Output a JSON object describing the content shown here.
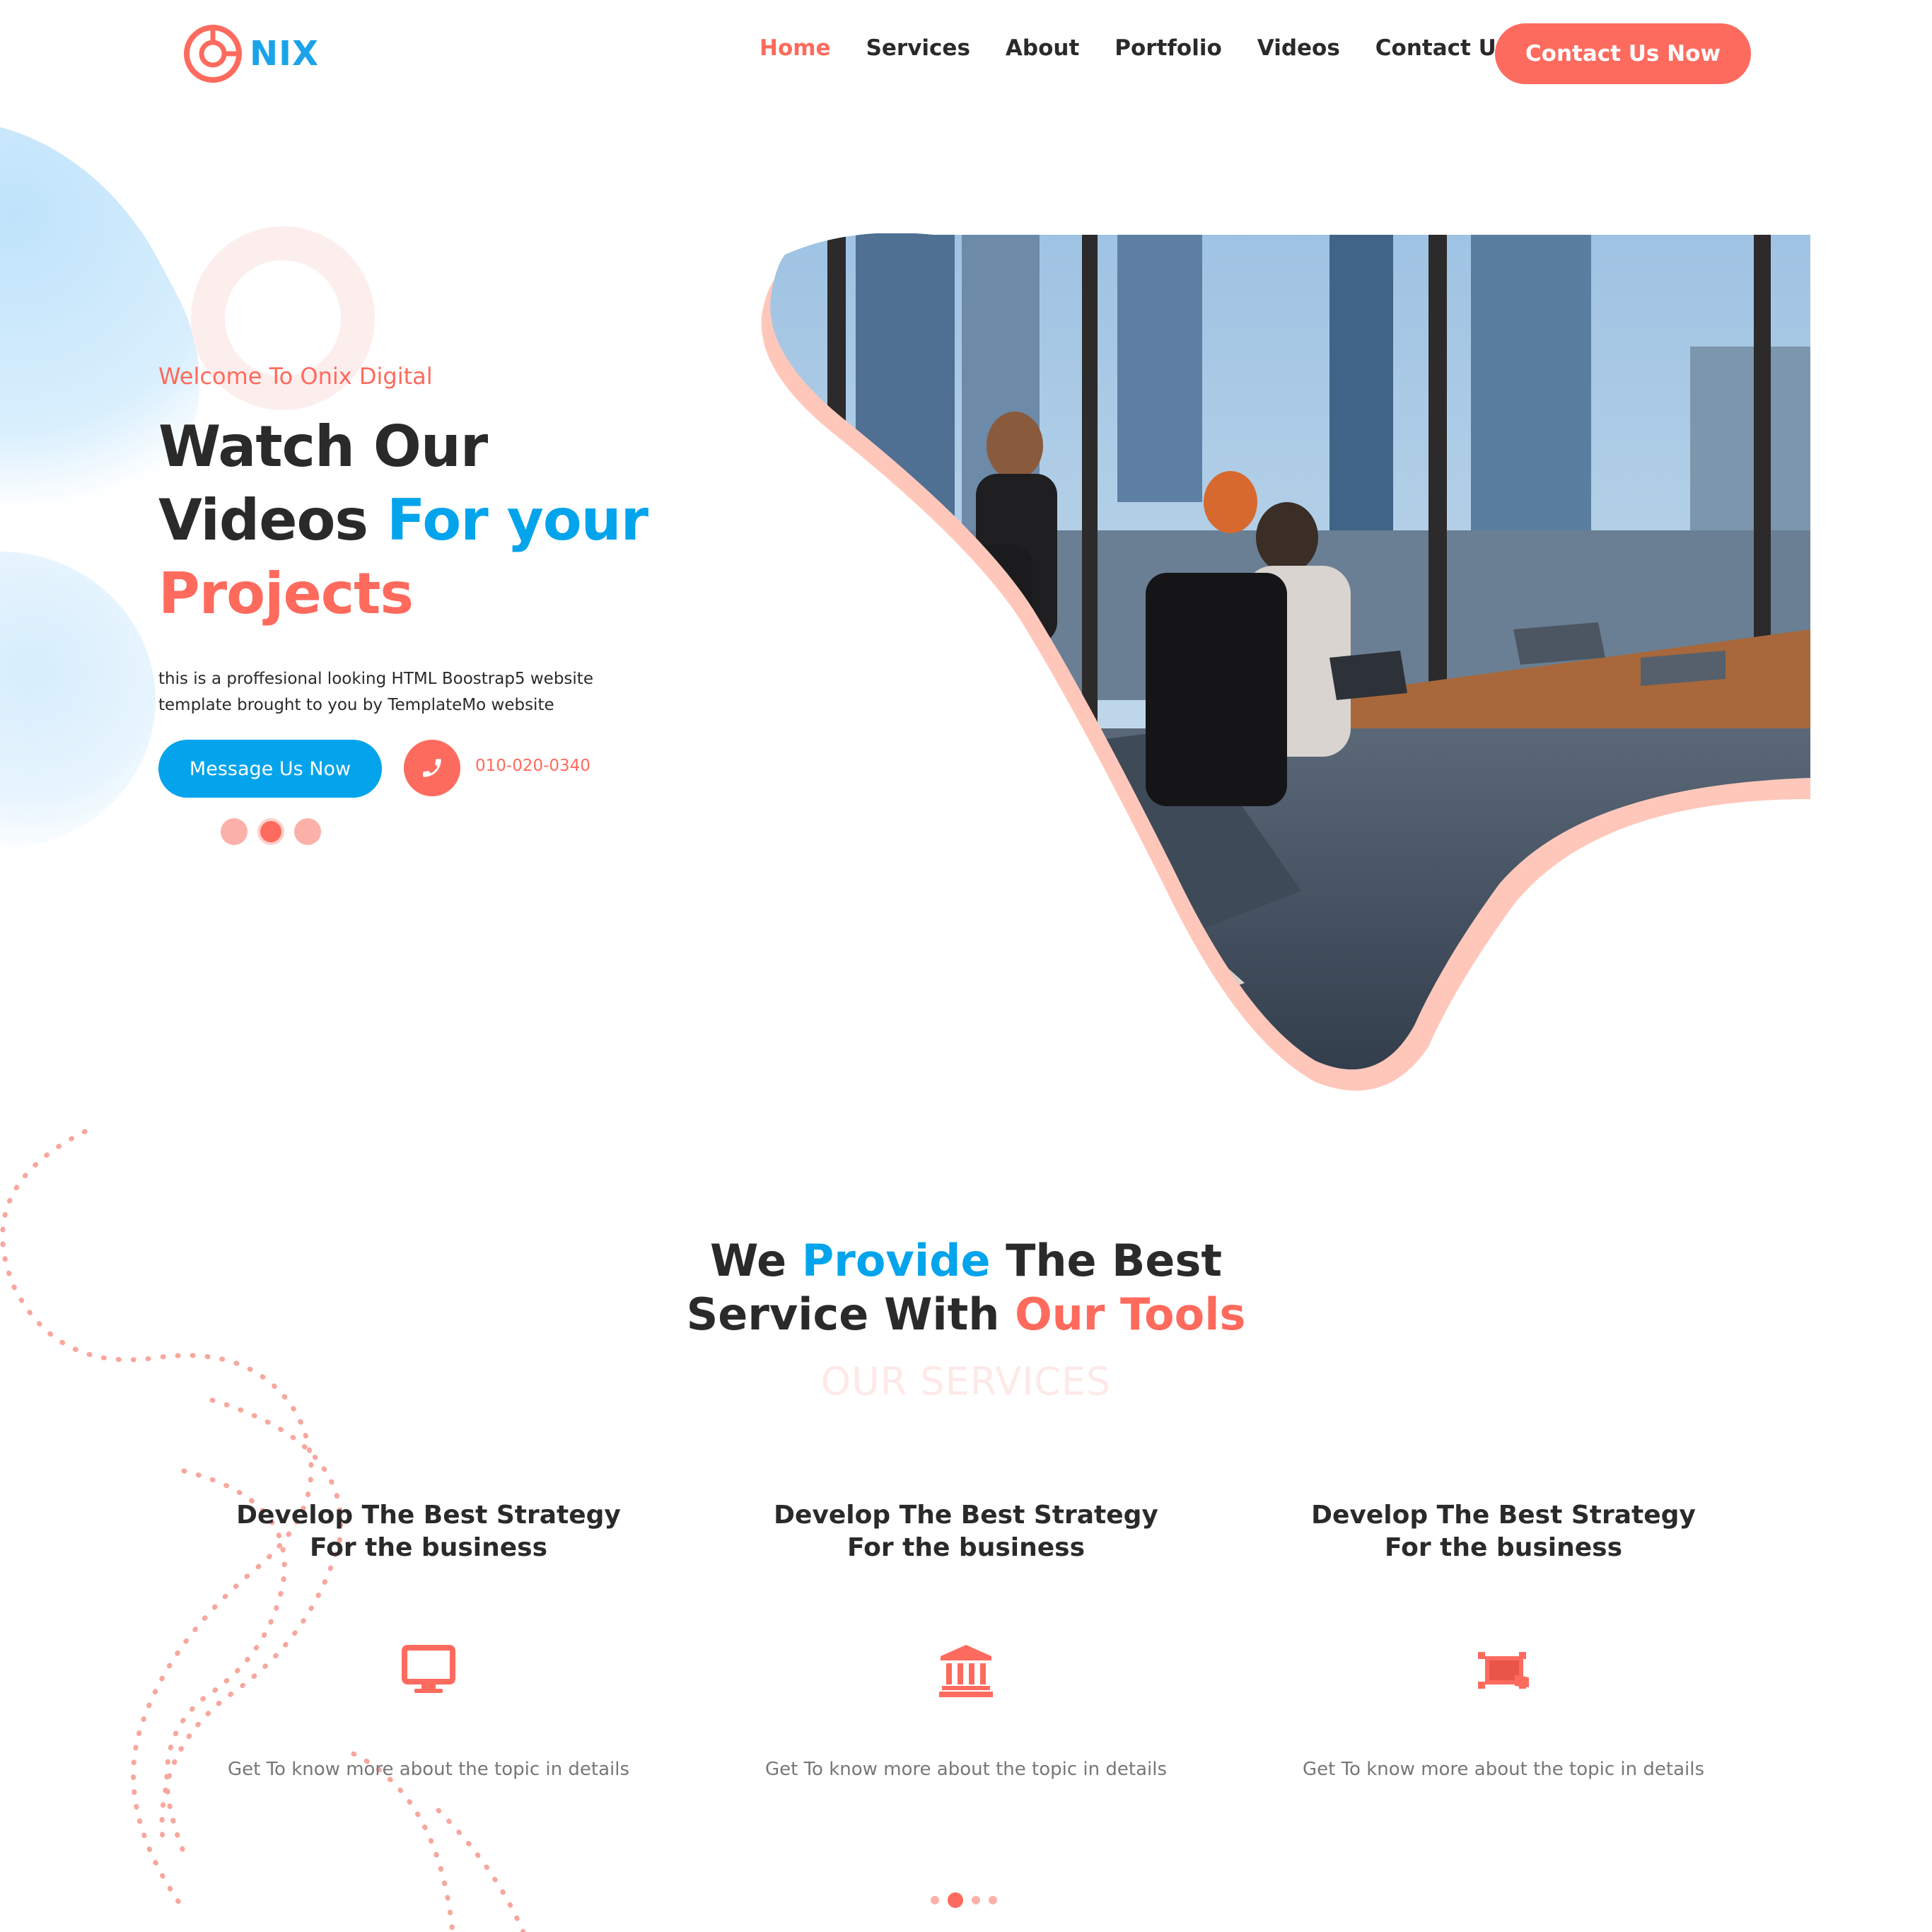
{
  "brand": {
    "logo_text": "NIX",
    "accent_color": "#fe6a5c",
    "blue_color": "#03a4ec"
  },
  "nav": {
    "items": [
      {
        "label": "Home",
        "active": true
      },
      {
        "label": "Services",
        "active": false
      },
      {
        "label": "About",
        "active": false
      },
      {
        "label": "Portfolio",
        "active": false
      },
      {
        "label": "Videos",
        "active": false
      },
      {
        "label": "Contact Us",
        "active": false
      }
    ],
    "cta": "Contact Us Now"
  },
  "hero": {
    "subtitle": "Welcome To Onix Digital",
    "title_line1": "Watch Our",
    "title_line2_a": "Videos",
    "title_line2_b": "For your",
    "title_line3": "Projects",
    "description": "this is a proffesional looking HTML Boostrap5 website template brought to you by TemplateMo website",
    "message_button": "Message Us Now",
    "phone": "010-020-0340",
    "phone_icon": "phone-icon",
    "slides": {
      "count": 3,
      "active": 2
    }
  },
  "services": {
    "title_a": "We",
    "title_b": "Provide",
    "title_c": "The Best",
    "title_d": "Service With",
    "title_e": "Our Tools",
    "watermark": "OUR SERVICES",
    "cards": [
      {
        "title_line1": "Develop The Best Strategy",
        "title_line2": "For the business",
        "icon": "monitor-icon",
        "text": "Get To know more about the topic in details"
      },
      {
        "title_line1": "Develop The Best Strategy",
        "title_line2": "For the business",
        "icon": "bank-icon",
        "text": "Get To know more about the topic in details"
      },
      {
        "title_line1": "Develop The Best Strategy",
        "title_line2": "For the business",
        "icon": "crop-icon",
        "text": "Get To know more about the topic in details"
      }
    ],
    "pager": {
      "count": 4,
      "active": 2
    }
  }
}
